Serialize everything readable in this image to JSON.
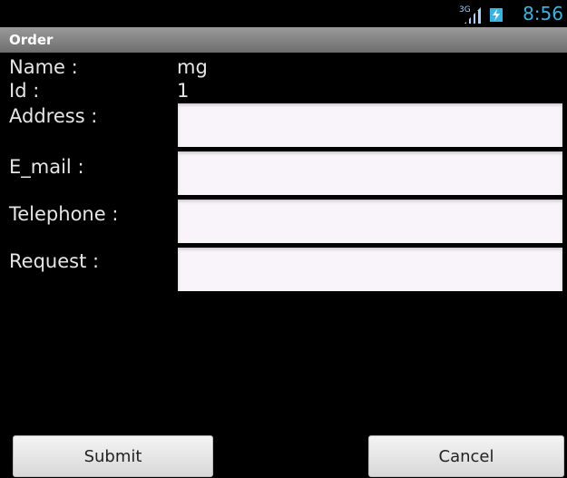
{
  "status_bar": {
    "network": "3G",
    "time": "8:56",
    "icons": [
      "signal-icon",
      "battery-charging-icon"
    ],
    "accent_color": "#33b5e5"
  },
  "title_bar": {
    "title": "Order"
  },
  "form": {
    "name_label": "Name :",
    "name_value": "mg",
    "id_label": "Id :",
    "id_value": "1",
    "address_label": "Address :",
    "address_value": "",
    "email_label": "E_mail :",
    "email_value": "",
    "telephone_label": "Telephone :",
    "telephone_value": "",
    "request_label": "Request :",
    "request_value": ""
  },
  "buttons": {
    "submit_label": "Submit",
    "cancel_label": "Cancel"
  }
}
